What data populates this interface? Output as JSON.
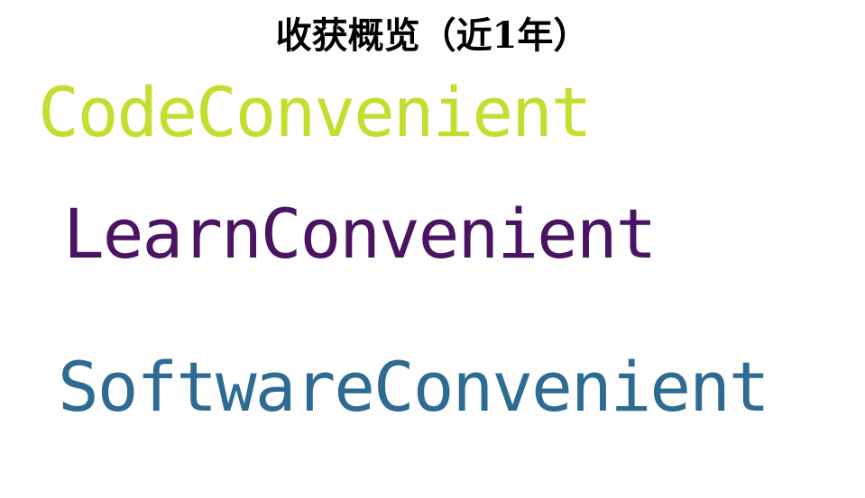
{
  "title": "收获概览（近1年）",
  "words": [
    {
      "text": "CodeConvenient",
      "color": "#c3de2f"
    },
    {
      "text": "LearnConvenient",
      "color": "#4b1463"
    },
    {
      "text": "SoftwareConvenient",
      "color": "#2e6b92"
    }
  ]
}
